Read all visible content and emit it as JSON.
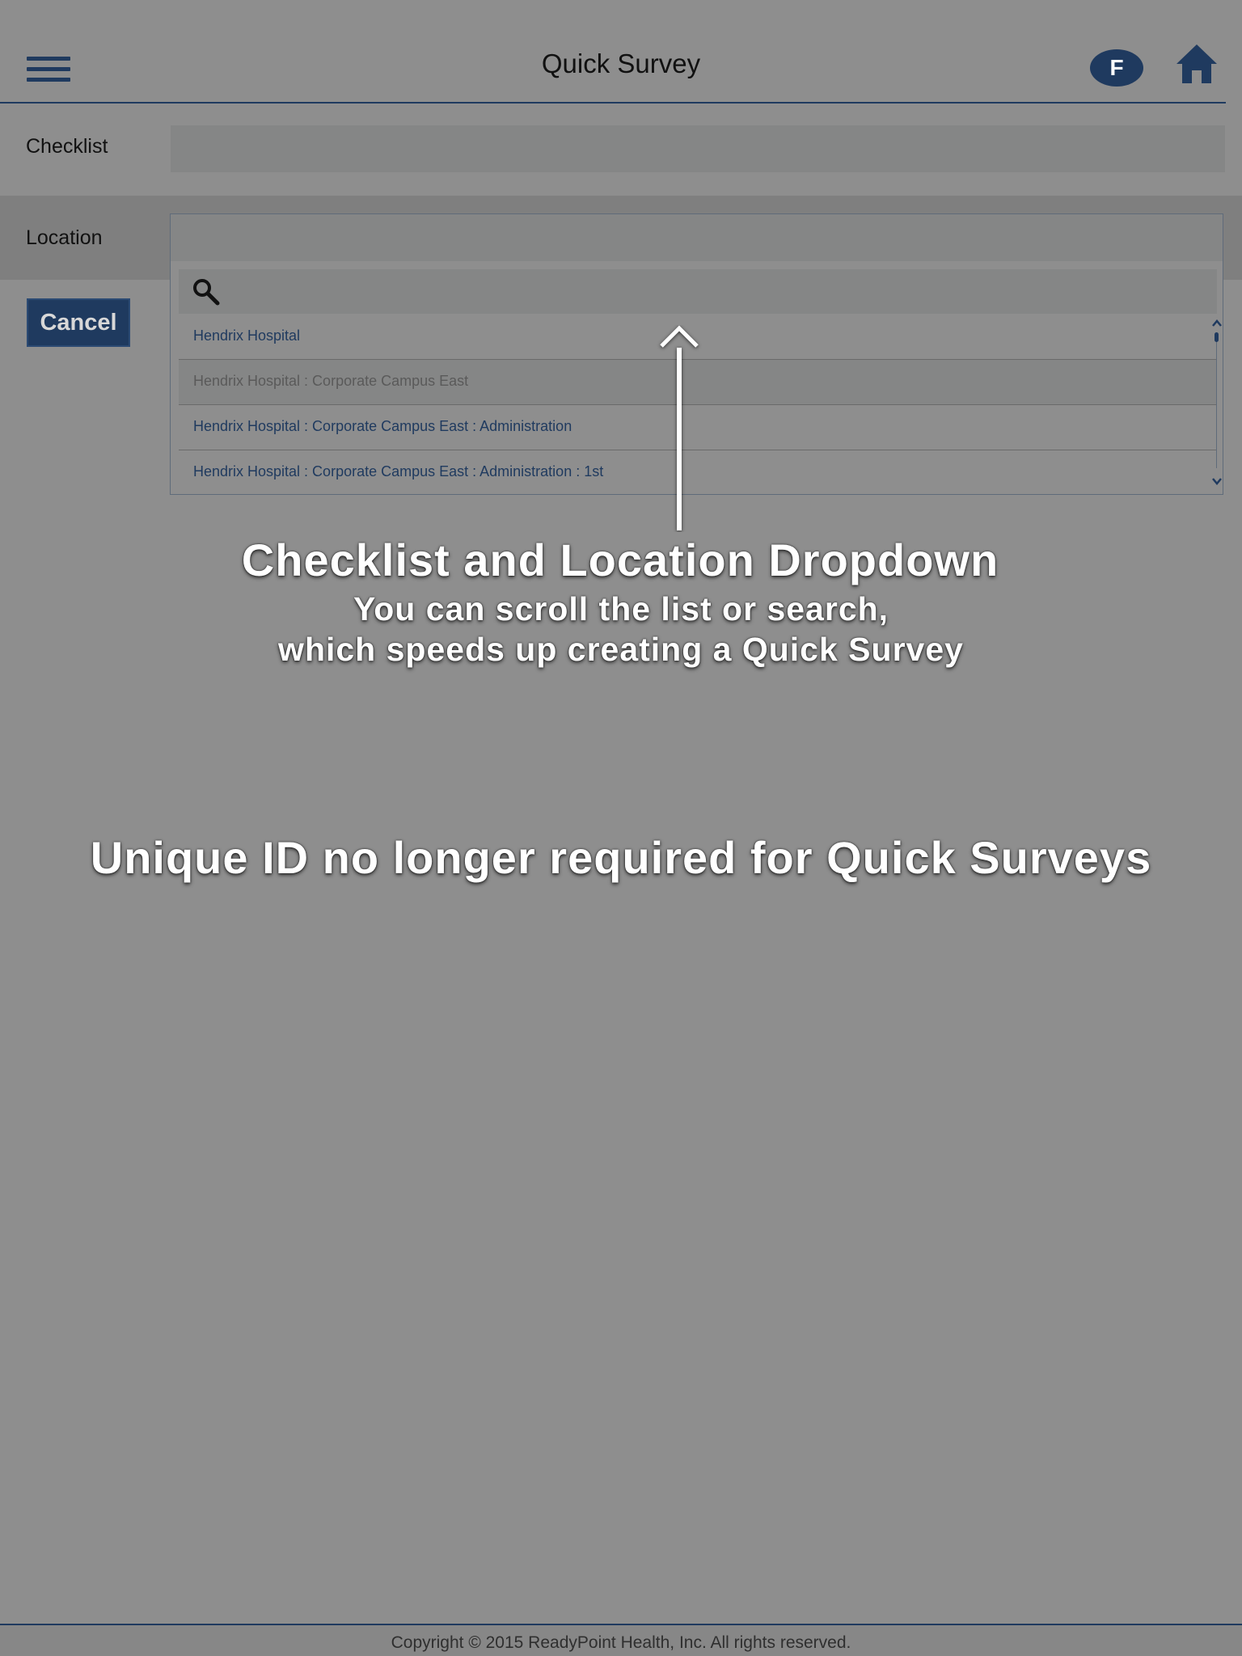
{
  "header": {
    "title": "Quick Survey",
    "avatar_initial": "F"
  },
  "form": {
    "checklist_label": "Checklist",
    "location_label": "Location",
    "cancel_label": "Cancel"
  },
  "location_dropdown": {
    "search_placeholder": "",
    "items": [
      "Hendrix Hospital",
      "Hendrix Hospital : Corporate Campus East",
      "Hendrix Hospital : Corporate Campus East : Administration",
      "Hendrix Hospital : Corporate Campus East : Administration : 1st"
    ]
  },
  "annotations": {
    "title": "Checklist and Location Dropdown",
    "line1": "You can scroll the list or search,",
    "line2": "which speeds up creating a Quick Survey",
    "unique_id": "Unique ID no longer required for Quick Surveys"
  },
  "footer": {
    "copyright": "Copyright © 2015 ReadyPoint Health, Inc. All rights reserved."
  },
  "icons": [
    "menu-icon",
    "home-icon",
    "search-icon",
    "chevron-up-icon",
    "chevron-down-icon",
    "arrow-up-icon"
  ],
  "colors": {
    "accent": "#1f3a5f",
    "overlay_bg": "#8e8e8e"
  }
}
